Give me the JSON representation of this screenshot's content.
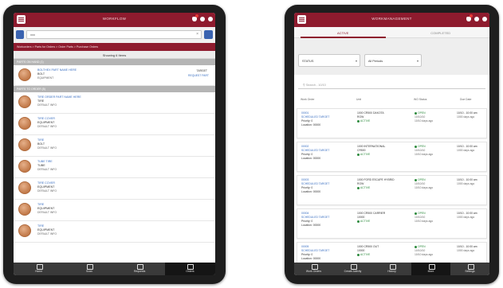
{
  "left": {
    "header": {
      "title": "WORKFLOW"
    },
    "search": {
      "value": "xxx"
    },
    "breadcrumb": "Workorders > Parts for Orders > Order Parts > Purchase Orders",
    "showing": "Showing 6 Items",
    "group1": "PARTS ON HAND (1)",
    "group2": "PARTS TO ORDER (5)",
    "items": [
      {
        "t1": "BOLTHEX PART NAME HERE",
        "t2": "BOLT",
        "t3": "EQUIPMENT",
        "r1": "TARGET",
        "r2": "REQUEST PART"
      },
      {
        "t1": "TIRE ORDER PART NAME HERE",
        "t2": "TIRE",
        "t3": "DEFAULT INFO"
      },
      {
        "t1": "TIRE COVER",
        "t2": "EQUIPMENT",
        "t3": "DEFAULT INFO"
      },
      {
        "t1": "TIRE",
        "t2": "BOLT",
        "t3": "DEFAULT INFO"
      },
      {
        "t1": "TUBE TIRE",
        "t2": "TUBE",
        "t3": "DEFAULT INFO"
      },
      {
        "t1": "TIRE COVER",
        "t2": "EQUIPMENT",
        "t3": "DEFAULT INFO"
      },
      {
        "t1": "TIRE",
        "t2": "EQUIPMENT",
        "t3": "DEFAULT INFO"
      },
      {
        "t1": "TIRE",
        "t2": "EQUIPMENT",
        "t3": "DEFAULT INFO"
      }
    ],
    "nav": [
      "Home",
      "Scan",
      "Requests",
      "Orders"
    ]
  },
  "right": {
    "header": {
      "title": "WORKMANAGEMENT"
    },
    "tabs": [
      "ACTIVE",
      "COMPLETED"
    ],
    "filter_status": "STATUS",
    "filter_period": "All Periods",
    "search_placeholder": "Search - 10/10",
    "columns": [
      "Work Order",
      "Unit",
      "WO Status",
      "Due Date"
    ],
    "cards": [
      {
        "wo": "00001",
        "sched": "SCHEDULED TARGET",
        "prio": "Priority: 0",
        "loc": "Location: 00000",
        "unit": "1000 CR500 DAKOTA",
        "unit2": "ROW",
        "status_label": "ACTIVE",
        "ws": "OPEN",
        "ws2": "10/10/10",
        "ws3": "10/10 days ago",
        "due1": "10/10 - 10:00 am",
        "due2": "1000 days ago"
      },
      {
        "wo": "00002",
        "sched": "SCHEDULED TARGET",
        "prio": "Priority: 0",
        "loc": "Location: 00000",
        "unit": "1000 INTERNATIONAL",
        "unit2": "CR500",
        "status_label": "ACTIVE",
        "ws": "OPEN",
        "ws2": "10/10/10",
        "ws3": "10/10 days ago",
        "due1": "10/10 - 10:00 am",
        "due2": "1000 days ago"
      },
      {
        "wo": "00003",
        "sched": "SCHEDULED TARGET",
        "prio": "Priority: 0",
        "loc": "Location: 00000",
        "unit": "1000 FORD ESCAPE HYBRID",
        "unit2": "ROW",
        "status_label": "ACTIVE",
        "ws": "OPEN",
        "ws2": "10/10/10",
        "ws3": "10/10 days ago",
        "due1": "10/10 - 10:00 am",
        "due2": "1000 days ago"
      },
      {
        "wo": "00004",
        "sched": "SCHEDULED TARGET",
        "prio": "Priority: 0",
        "loc": "Location: 00000",
        "unit": "1000 CR500 CARRIER",
        "unit2": "10000",
        "status_label": "ACTIVE",
        "ws": "OPEN",
        "ws2": "10/10/10",
        "ws3": "10/10 days ago",
        "due1": "10/10 - 10:00 am",
        "due2": "1000 days ago"
      },
      {
        "wo": "00005",
        "sched": "SCHEDULED TARGET",
        "prio": "Priority: 0",
        "loc": "Location: 00000",
        "unit": "1000 CR500 OUT",
        "unit2": "10000",
        "status_label": "ACTIVE",
        "ws": "OPEN",
        "ws2": "10/10/10",
        "ws3": "10/10 days ago",
        "due1": "10/10 - 10:00 am",
        "due2": "1000 days ago"
      }
    ],
    "nav": [
      "Work Orders",
      "Create Activity",
      "History",
      "More",
      "Settings"
    ]
  }
}
